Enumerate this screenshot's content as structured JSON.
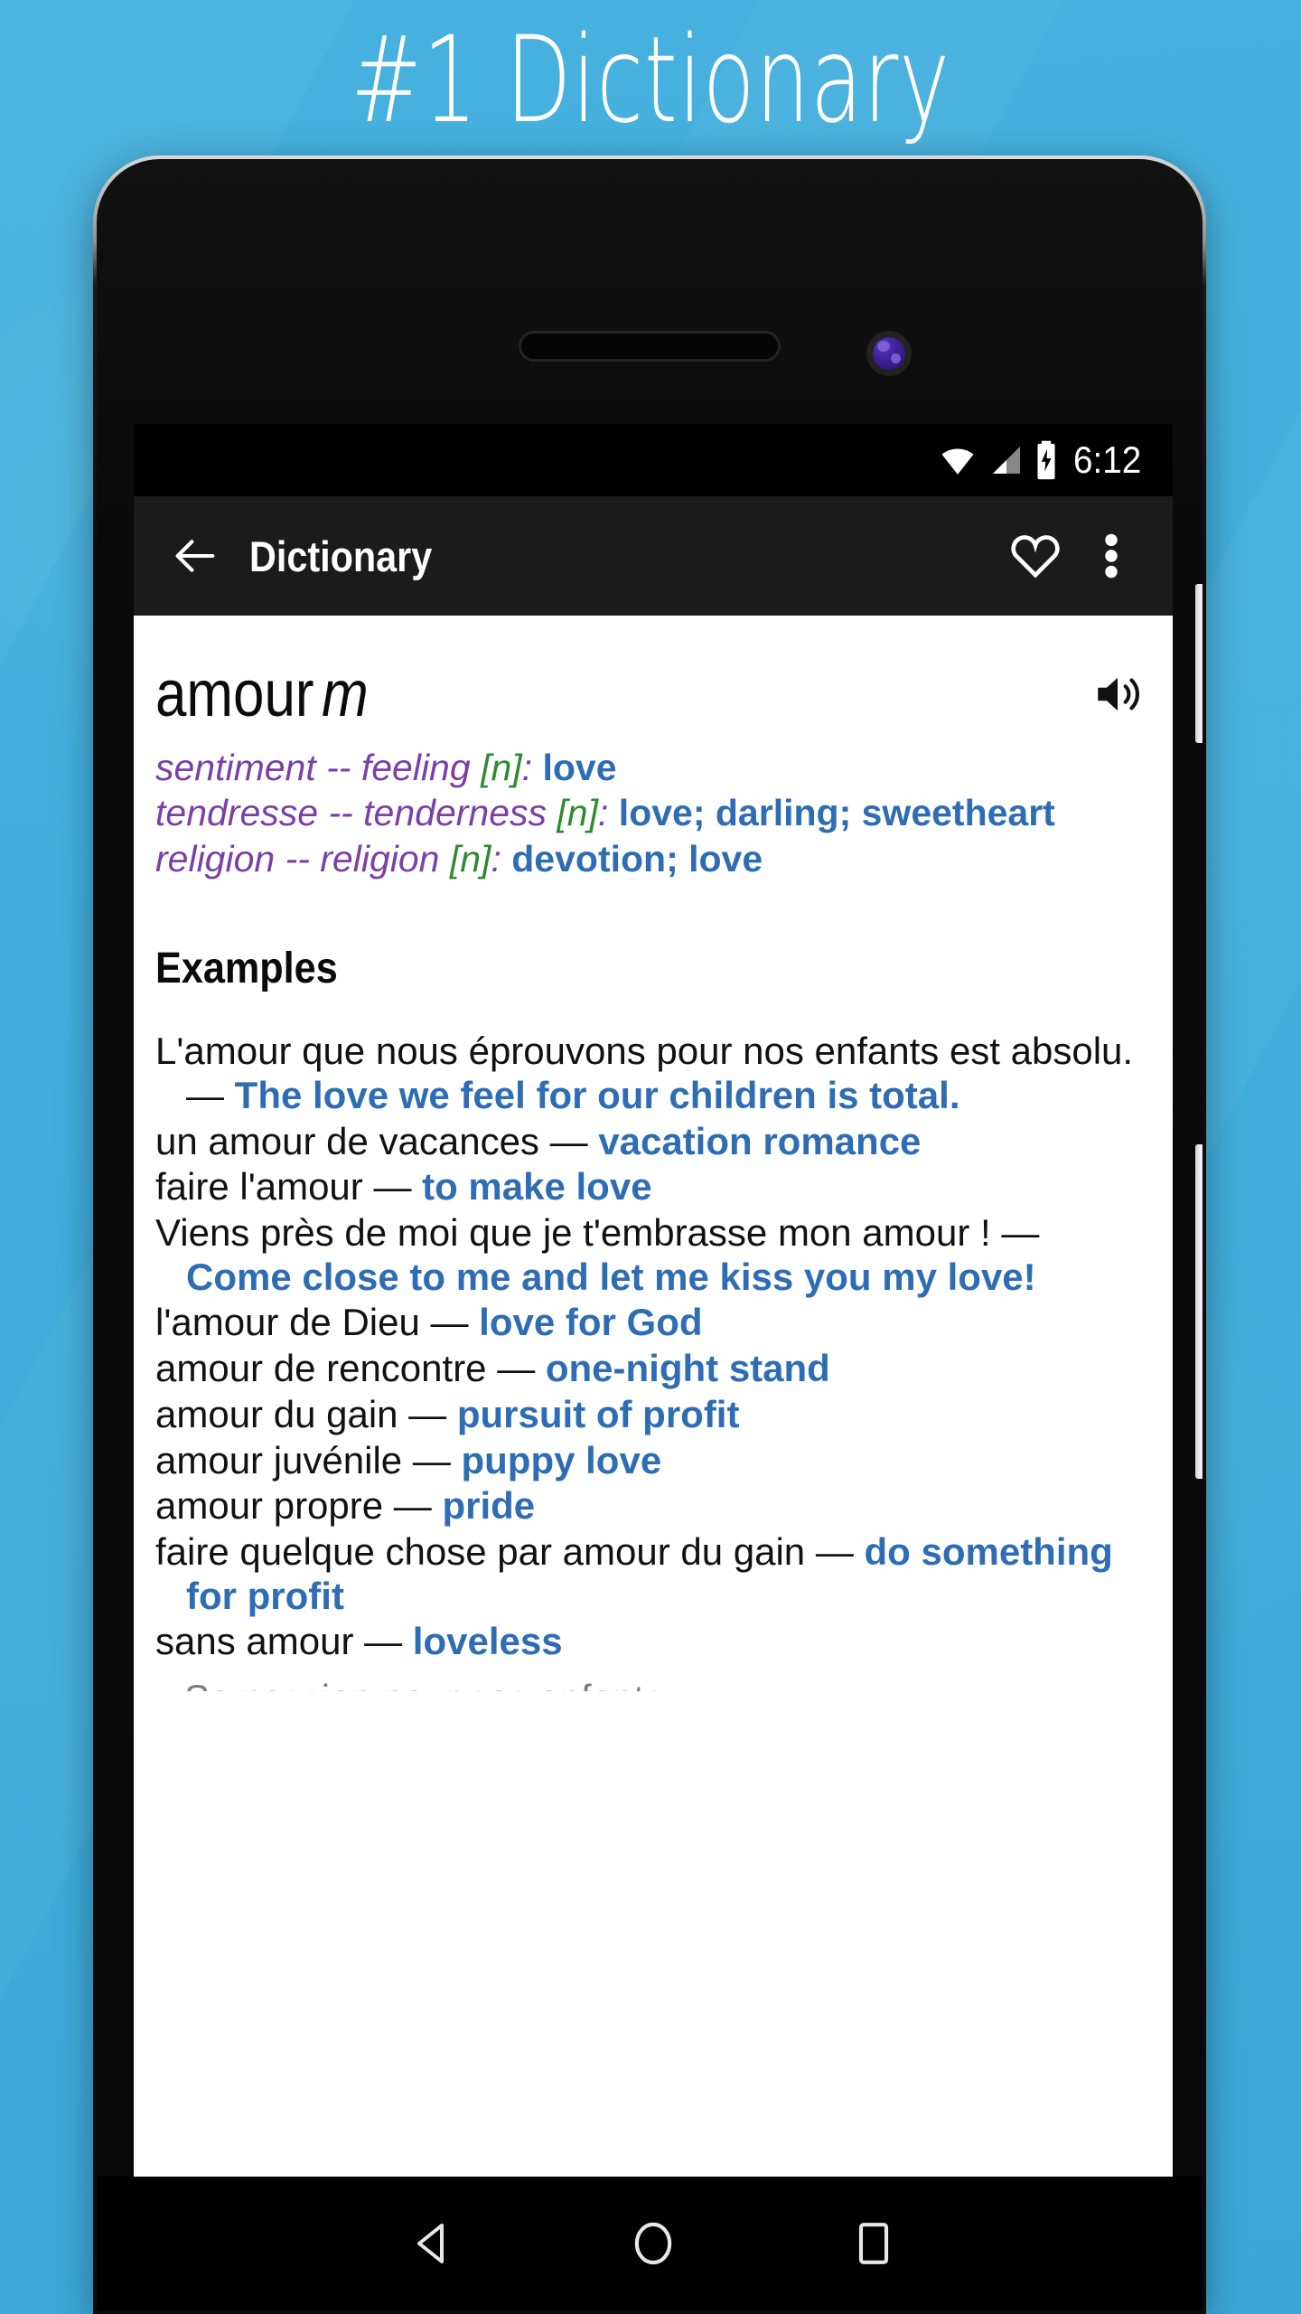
{
  "promo": {
    "title": "#1 Dictionary",
    "background_color": "#42AEDC"
  },
  "device": {
    "buttons": [
      "power-button",
      "volume-button"
    ],
    "front_camera": "front-camera-lens",
    "earpiece": "earpiece-speaker"
  },
  "status_bar": {
    "time": "6:12",
    "icons": [
      "wifi-icon",
      "signal-icon",
      "battery-charging-icon"
    ]
  },
  "app_bar": {
    "back_label": "back-arrow",
    "title": "Dictionary",
    "favorite_label": "heart-outline",
    "overflow_label": "more-vertical"
  },
  "entry": {
    "headword": "amour",
    "gender": "m",
    "speaker_label": "volume-speaker",
    "senses": [
      {
        "domain_fr": "sentiment",
        "dash": " -- ",
        "domain_en": "feeling",
        "pos": "[n]",
        "colon": ":",
        "translations": [
          "love"
        ]
      },
      {
        "domain_fr": "tendresse",
        "dash": " -- ",
        "domain_en": "tenderness",
        "pos": "[n]",
        "colon": ":",
        "translations": [
          "love",
          "darling",
          "sweetheart"
        ]
      },
      {
        "domain_fr": "religion",
        "dash": " -- ",
        "domain_en": "religion",
        "pos": "[n]",
        "colon": ":",
        "translations": [
          "devotion",
          "love"
        ]
      }
    ]
  },
  "examples": {
    "heading": "Examples",
    "items": [
      {
        "fr": "L'amour que nous éprouvons pour nos enfants est absolu. — ",
        "en": "The love we feel for our children is total."
      },
      {
        "fr": "un amour de vacances — ",
        "en": "vacation romance"
      },
      {
        "fr": "faire l'amour — ",
        "en": "to make love"
      },
      {
        "fr": "Viens près de moi que je t'embrasse mon amour ! — ",
        "en": "Come close to me and let me kiss you my love!"
      },
      {
        "fr": "l'amour de Dieu — ",
        "en": "love for God"
      },
      {
        "fr": "amour de rencontre — ",
        "en": "one-night stand"
      },
      {
        "fr": "amour du gain — ",
        "en": "pursuit of profit"
      },
      {
        "fr": "amour juvénile — ",
        "en": "puppy love"
      },
      {
        "fr": "amour propre — ",
        "en": "pride"
      },
      {
        "fr": "faire quelque chose par amour du gain — ",
        "en": "do something for profit"
      },
      {
        "fr": "sans amour — ",
        "en": "loveless"
      }
    ],
    "clipped_next_line": "Sa passion pour ses enfants"
  },
  "nav_bar": {
    "back": "nav-back-triangle",
    "home": "nav-home-circle",
    "recents": "nav-recents-square"
  },
  "colors": {
    "promo_blue": "#42AEDC",
    "translation_blue": "#2E6DB4",
    "domain_purple": "#7B3FA8",
    "pos_green": "#2D8A2D",
    "app_bar_black": "#1B1B1B",
    "status_bar_black": "#000000"
  }
}
